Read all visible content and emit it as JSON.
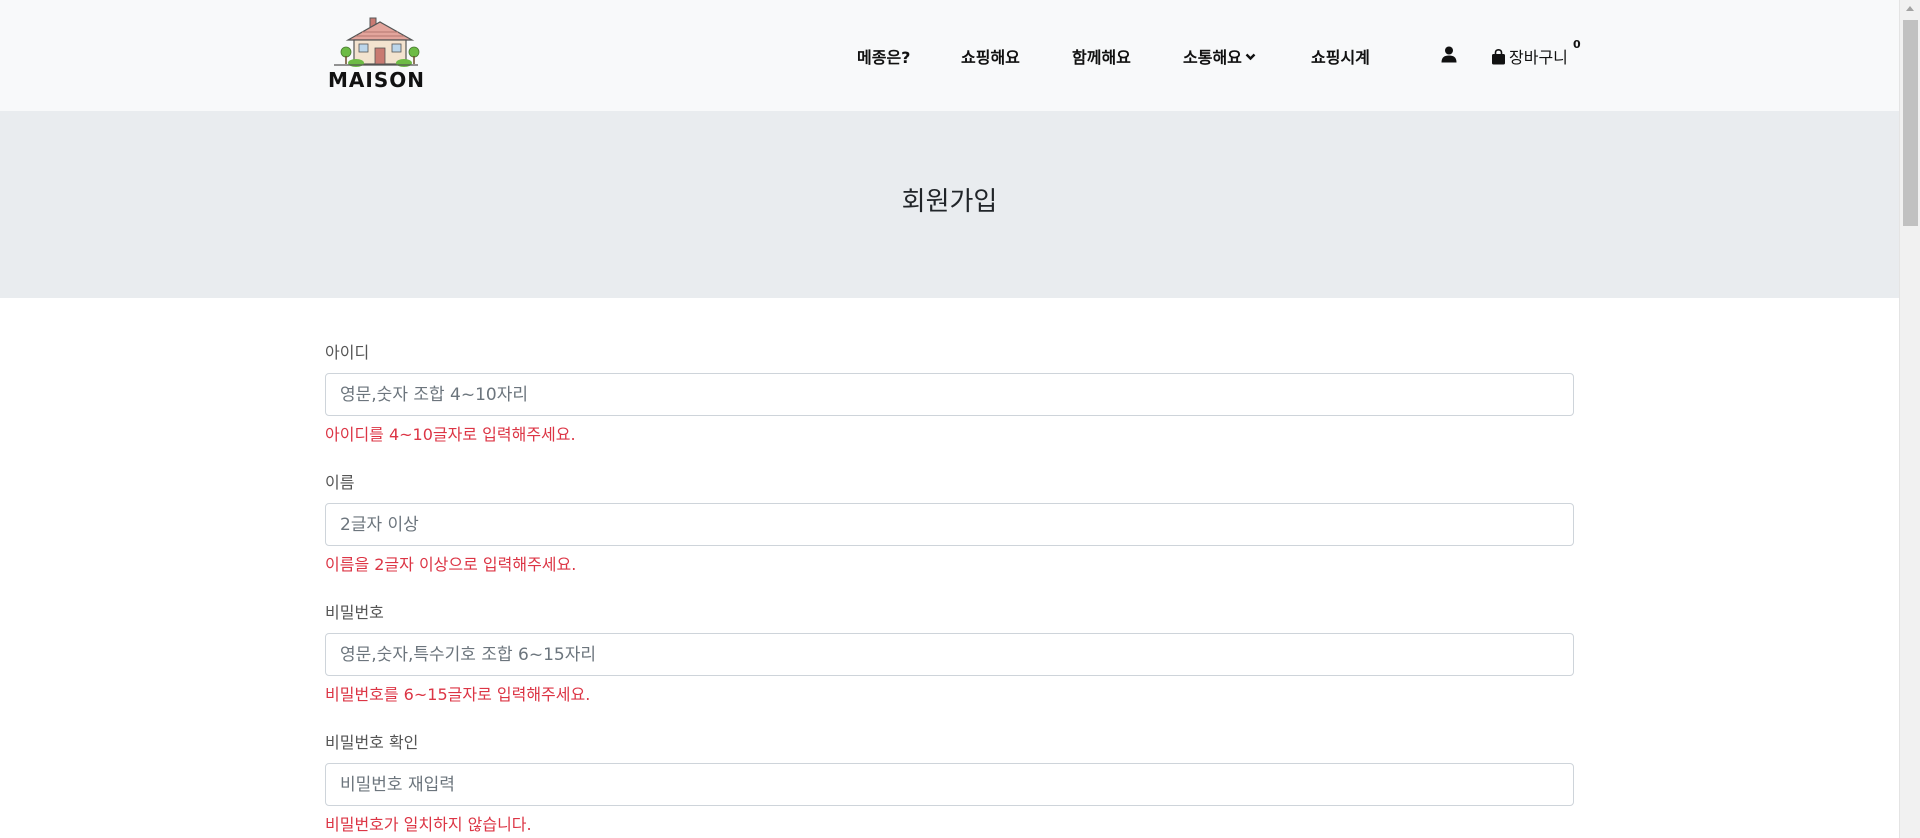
{
  "brand": {
    "name": "MAISON"
  },
  "nav": {
    "items": [
      {
        "label": "메종은?"
      },
      {
        "label": "쇼핑해요"
      },
      {
        "label": "함께해요"
      },
      {
        "label": "소통해요"
      },
      {
        "label": "쇼핑시계"
      }
    ],
    "cart_label": "장바구니",
    "cart_count": "0"
  },
  "banner": {
    "title": "회원가입"
  },
  "form": {
    "fields": [
      {
        "label": "아이디",
        "placeholder": "영문,숫자 조합 4~10자리",
        "error": "아이디를 4~10글자로 입력해주세요."
      },
      {
        "label": "이름",
        "placeholder": "2글자 이상",
        "error": "이름을 2글자 이상으로 입력해주세요."
      },
      {
        "label": "비밀번호",
        "placeholder": "영문,숫자,특수기호 조합 6~15자리",
        "error": "비밀번호를 6~15글자로 입력해주세요."
      },
      {
        "label": "비밀번호 확인",
        "placeholder": "비밀번호 재입력",
        "error": "비밀번호가 일치하지 않습니다."
      }
    ]
  },
  "icons": {
    "user": "user-icon",
    "cart": "shopping-bag-icon",
    "dropdown": "chevron-down-icon",
    "logo": "house-logo-icon"
  },
  "colors": {
    "header_bg": "#f8f9fa",
    "banner_bg": "#e9ecef",
    "error": "#dc3545",
    "input_border": "#ced4da"
  }
}
